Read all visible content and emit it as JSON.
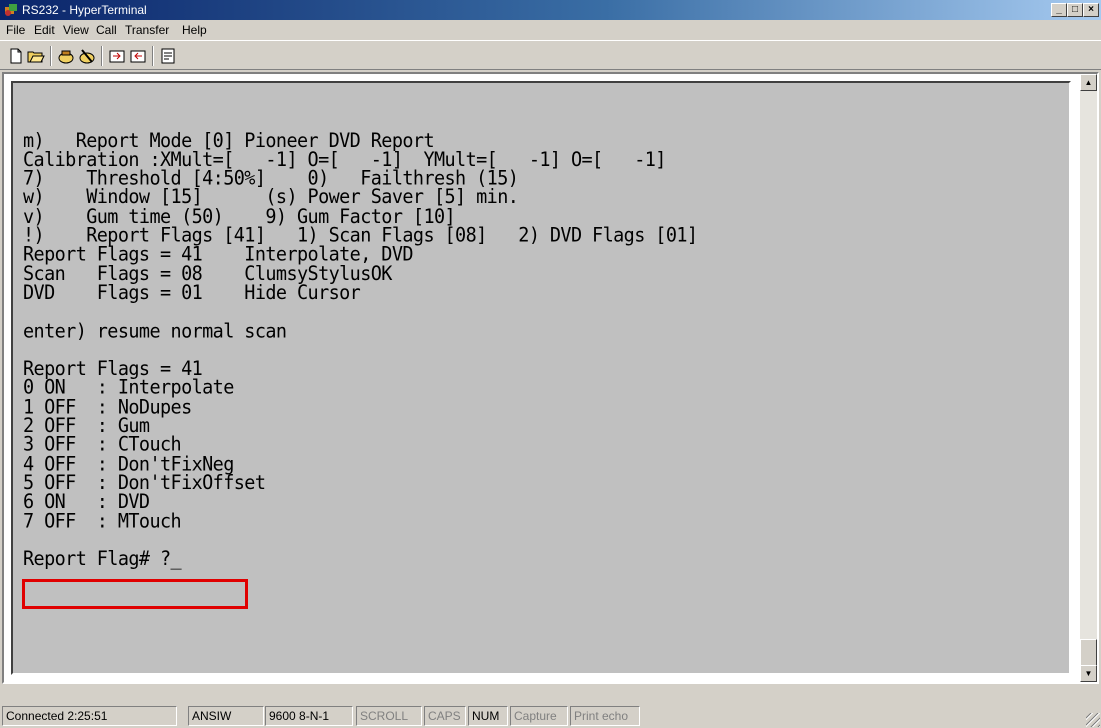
{
  "window": {
    "title": "RS232 - HyperTerminal",
    "icon": "hyperterminal-icon"
  },
  "menu": [
    "File",
    "Edit",
    "View",
    "Call",
    "Transfer",
    "Help"
  ],
  "toolbar": [
    "new-icon",
    "open-icon",
    "connect-icon",
    "disconnect-icon",
    "send-icon",
    "receive-icon",
    "properties-icon"
  ],
  "terminal": {
    "lines": [
      "",
      "",
      "m)   Report Mode [0] Pioneer DVD Report",
      "Calibration :XMult=[   -1] O=[   -1]  YMult=[   -1] O=[   -1]",
      "7)    Threshold [4:50%]    0)   Failthresh (15)",
      "w)    Window [15]      (s) Power Saver [5] min.",
      "v)    Gum time (50)    9) Gum Factor [10]",
      "!)    Report Flags [41]   1) Scan Flags [08]   2) DVD Flags [01]",
      "Report Flags = 41    Interpolate, DVD",
      "Scan   Flags = 08    ClumsyStylusOK",
      "DVD    Flags = 01    Hide Cursor",
      "",
      "enter) resume normal scan",
      "",
      "Report Flags = 41",
      "0 ON   : Interpolate",
      "1 OFF  : NoDupes",
      "2 OFF  : Gum",
      "3 OFF  : CTouch",
      "4 OFF  : Don'tFixNeg",
      "5 OFF  : Don'tFixOffset",
      "6 ON   : DVD",
      "7 OFF  : MTouch",
      "",
      "Report Flag# ?_"
    ],
    "highlighted_line": "6 ON   : DVD",
    "highlight_color": "#e00000",
    "background_color": "#c0c0c0"
  },
  "statusbar": {
    "connected": "Connected 2:25:51",
    "emulation": "ANSIW",
    "settings": "9600 8-N-1",
    "scroll": "SCROLL",
    "caps": "CAPS",
    "num": "NUM",
    "capture": "Capture",
    "print_echo": "Print echo"
  }
}
